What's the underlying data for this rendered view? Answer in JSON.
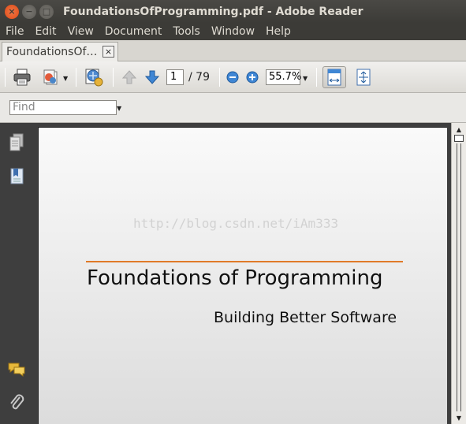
{
  "window": {
    "title": "FoundationsOfProgramming.pdf - Adobe Reader",
    "close_glyph": "×",
    "minimize_glyph": "−",
    "maximize_glyph": "□"
  },
  "menu": {
    "items": [
      "File",
      "Edit",
      "View",
      "Document",
      "Tools",
      "Window",
      "Help"
    ]
  },
  "tab": {
    "label": "FoundationsOf…",
    "close_glyph": "×"
  },
  "toolbar": {
    "print_icon": "printer-icon",
    "share_icon": "share-icon",
    "collab_icon": "collaborate-icon",
    "prev_icon": "arrow-up-icon",
    "next_icon": "arrow-down-icon",
    "page_current": "1",
    "page_total": "/ 79",
    "zoom_value": "55.7%",
    "zoom_out_icon": "zoom-out-icon",
    "zoom_in_icon": "zoom-in-icon",
    "fit_width_icon": "fit-width-icon",
    "fit_page_icon": "fit-page-icon"
  },
  "find": {
    "placeholder": "Find"
  },
  "leftnav": {
    "icons": [
      "pages-icon",
      "bookmarks-icon",
      "comments-icon",
      "attachments-icon"
    ]
  },
  "document": {
    "watermark": "http://blog.csdn.net/iAm333",
    "title": "Foundations of Programming",
    "subtitle": "Building Better Software",
    "rule_color": "#e07a28"
  }
}
